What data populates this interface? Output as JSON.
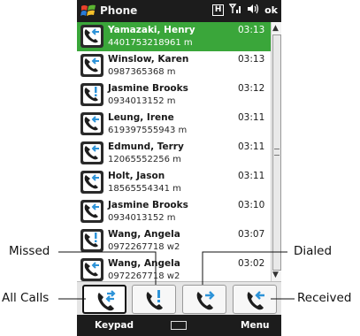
{
  "app_title": "Phone",
  "status": {
    "h_icon": "H",
    "signal_icon": "signal-icon",
    "volume_icon": "volume-icon",
    "ok_label": "ok"
  },
  "calls": [
    {
      "name": "Yamazaki, Henry",
      "number": "4401753218961 m",
      "time": "03:13",
      "type": "received",
      "selected": true
    },
    {
      "name": "Winslow, Karen",
      "number": "0987365368 m",
      "time": "03:13",
      "type": "received",
      "selected": false
    },
    {
      "name": "Jasmine Brooks",
      "number": "0934013152 m",
      "time": "03:12",
      "type": "missed",
      "selected": false
    },
    {
      "name": "Leung, Irene",
      "number": "619397555943 m",
      "time": "03:11",
      "type": "received",
      "selected": false
    },
    {
      "name": "Edmund, Terry",
      "number": "12065552256 m",
      "time": "03:11",
      "type": "received",
      "selected": false
    },
    {
      "name": "Holt, Jason",
      "number": "18565554341 m",
      "time": "03:11",
      "type": "received",
      "selected": false
    },
    {
      "name": "Jasmine Brooks",
      "number": "0934013152 m",
      "time": "03:10",
      "type": "received",
      "selected": false
    },
    {
      "name": "Wang, Angela",
      "number": "0972267718 w2",
      "time": "03:07",
      "type": "missed",
      "selected": false
    },
    {
      "name": "Wang, Angela",
      "number": "0972267718 w2",
      "time": "03:02",
      "type": "received",
      "selected": false
    }
  ],
  "tabs": [
    {
      "id": "all-calls",
      "icon": "all-calls-icon",
      "active": true
    },
    {
      "id": "missed",
      "icon": "missed-call-icon",
      "active": false
    },
    {
      "id": "dialed",
      "icon": "dialed-call-icon",
      "active": false
    },
    {
      "id": "received",
      "icon": "received-call-icon",
      "active": false
    }
  ],
  "softkeys": {
    "left": "Keypad",
    "right": "Menu",
    "center_icon": "keyboard-icon"
  },
  "callouts": {
    "missed": "Missed",
    "dialed": "Dialed",
    "all_calls": "All Calls",
    "received": "Received"
  }
}
